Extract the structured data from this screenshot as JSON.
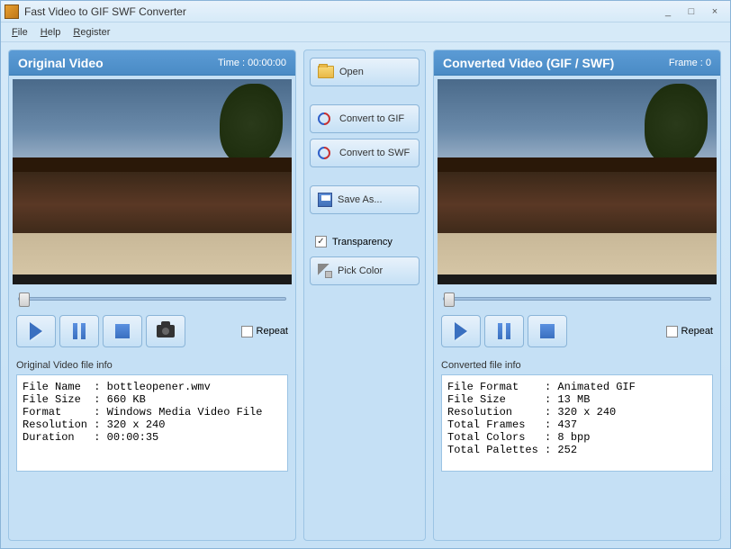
{
  "window": {
    "title": "Fast Video to GIF SWF Converter"
  },
  "menu": {
    "file": "File",
    "help": "Help",
    "register": "Register"
  },
  "leftPanel": {
    "title": "Original Video",
    "timeLabel": "Time : 00:00:00",
    "repeat": "Repeat",
    "infoLabel": "Original Video file info",
    "info": "File Name  : bottleopener.wmv\nFile Size  : 660 KB\nFormat     : Windows Media Video File\nResolution : 320 x 240\nDuration   : 00:00:35"
  },
  "rightPanel": {
    "title": "Converted Video (GIF / SWF)",
    "frameLabel": "Frame : 0",
    "repeat": "Repeat",
    "infoLabel": "Converted file info",
    "info": "File Format    : Animated GIF\nFile Size      : 13 MB\nResolution     : 320 x 240\nTotal Frames   : 437\nTotal Colors   : 8 bpp\nTotal Palettes : 252"
  },
  "center": {
    "open": "Open",
    "convertGif": "Convert to GIF",
    "convertSwf": "Convert to SWF",
    "saveAs": "Save As...",
    "transparency": "Transparency",
    "pickColor": "Pick Color"
  }
}
